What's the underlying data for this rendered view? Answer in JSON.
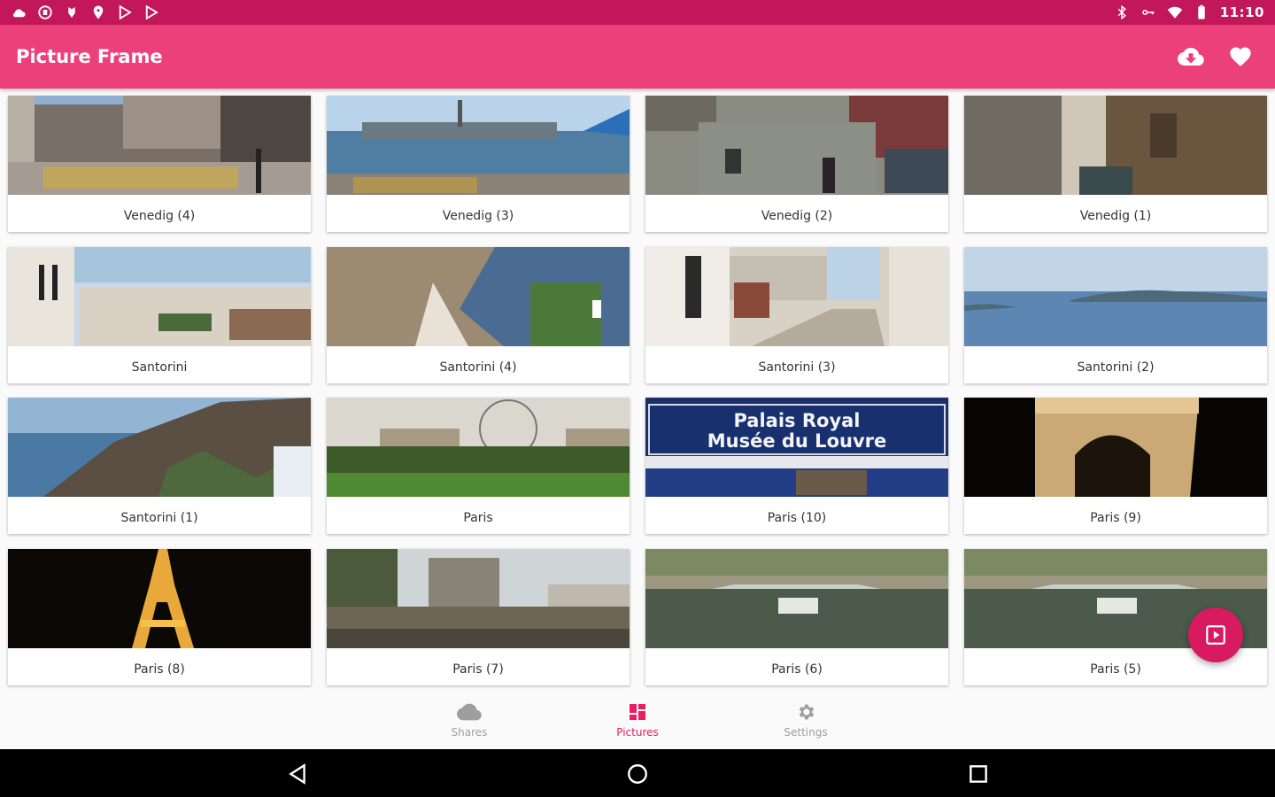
{
  "status_bar": {
    "time": "11:10",
    "left_icons": [
      "cloud-icon",
      "dropbox-icon",
      "notification-icon",
      "location-icon",
      "play-store-icon",
      "play-store-icon-2"
    ],
    "right_icons": [
      "bluetooth-icon",
      "vpn-key-icon",
      "wifi-icon",
      "battery-icon"
    ]
  },
  "app_bar": {
    "title": "Picture Frame",
    "actions": [
      "cloud-download-icon",
      "heart-icon"
    ]
  },
  "colors": {
    "status_bar": "#c2185b",
    "app_bar": "#ec407a",
    "accent": "#e91e63",
    "fab": "#d81b60"
  },
  "grid": {
    "items": [
      {
        "label": "Venedig (4)",
        "scene": "piazza"
      },
      {
        "label": "Venedig (3)",
        "scene": "lagoon"
      },
      {
        "label": "Venedig (2)",
        "scene": "canal"
      },
      {
        "label": "Venedig (1)",
        "scene": "alley-canal"
      },
      {
        "label": "Santorini",
        "scene": "village"
      },
      {
        "label": "Santorini (4)",
        "scene": "cliff-sea"
      },
      {
        "label": "Santorini (3)",
        "scene": "street"
      },
      {
        "label": "Santorini (2)",
        "scene": "sea-island"
      },
      {
        "label": "Santorini (1)",
        "scene": "caldera"
      },
      {
        "label": "Paris",
        "scene": "park-wheel"
      },
      {
        "label": "Paris (10)",
        "scene": "metro-sign"
      },
      {
        "label": "Paris (9)",
        "scene": "arc-night"
      },
      {
        "label": "Paris (8)",
        "scene": "eiffel-night"
      },
      {
        "label": "Paris (7)",
        "scene": "notre-dame"
      },
      {
        "label": "Paris (6)",
        "scene": "seine-boat"
      },
      {
        "label": "Paris (5)",
        "scene": "seine-boat"
      }
    ],
    "metro_sign_line1": "Palais Royal",
    "metro_sign_line2": "Musée du Louvre"
  },
  "fab": {
    "icon": "slideshow-icon"
  },
  "bottom_nav": {
    "items": [
      {
        "label": "Shares",
        "icon": "cloud-icon",
        "active": false
      },
      {
        "label": "Pictures",
        "icon": "dashboard-icon",
        "active": true
      },
      {
        "label": "Settings",
        "icon": "gear-icon",
        "active": false
      }
    ]
  },
  "system_nav": [
    "back-icon",
    "home-icon",
    "recents-icon"
  ]
}
